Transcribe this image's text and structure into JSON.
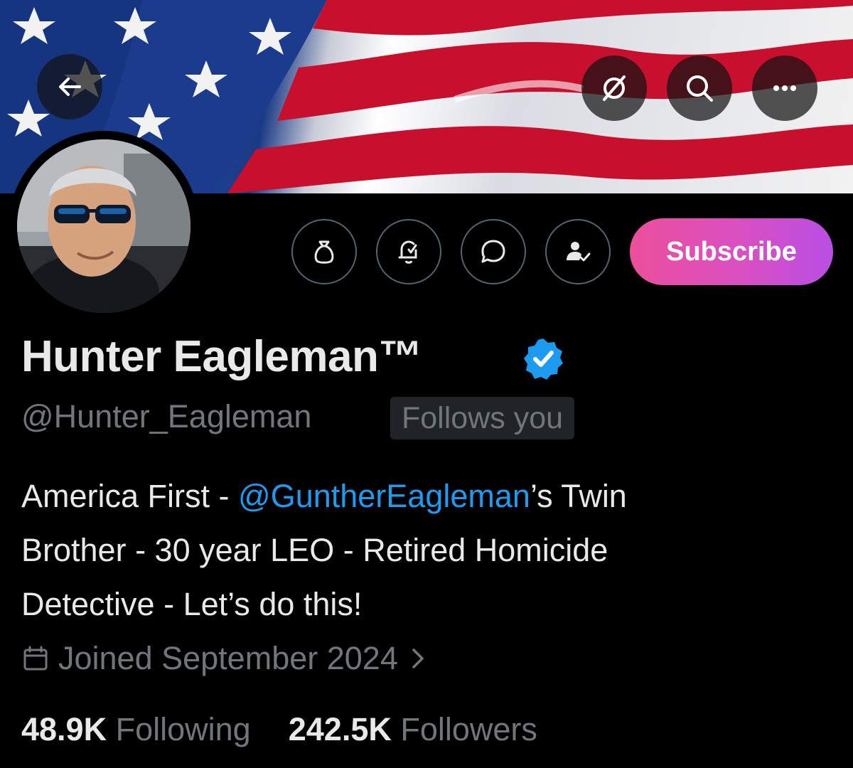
{
  "header": {
    "back_icon": "arrow-left-icon",
    "grok_icon": "slash-circle-icon",
    "search_icon": "search-icon",
    "more_icon": "more-horizontal-icon"
  },
  "banner": {
    "description_icon": "american-flag-banner"
  },
  "actions": {
    "icons": [
      "money-bag-icon",
      "bell-plus-icon",
      "message-icon",
      "person-check-icon"
    ],
    "subscribe_label": "Subscribe"
  },
  "profile": {
    "name": "Hunter Eagleman™",
    "handle": "@Hunter_Eagleman",
    "follows_you": "Follows you",
    "bio_prefix": "America First - ",
    "bio_mention": "@GuntherEagleman",
    "bio_suffix_line1": "’s Twin",
    "bio_line2": "Brother - 30 year LEO - Retired Homicide",
    "bio_line3": "Detective - Let’s do this!",
    "joined": "Joined September 2024"
  },
  "stats": {
    "following_count": "48.9K",
    "following_label": "Following",
    "followers_count": "242.5K",
    "followers_label": "Followers"
  },
  "colors": {
    "accent": "#1d9bf0",
    "muted": "#71767b",
    "subscribe_start": "#ec4f9b",
    "subscribe_end": "#b84fe4"
  }
}
